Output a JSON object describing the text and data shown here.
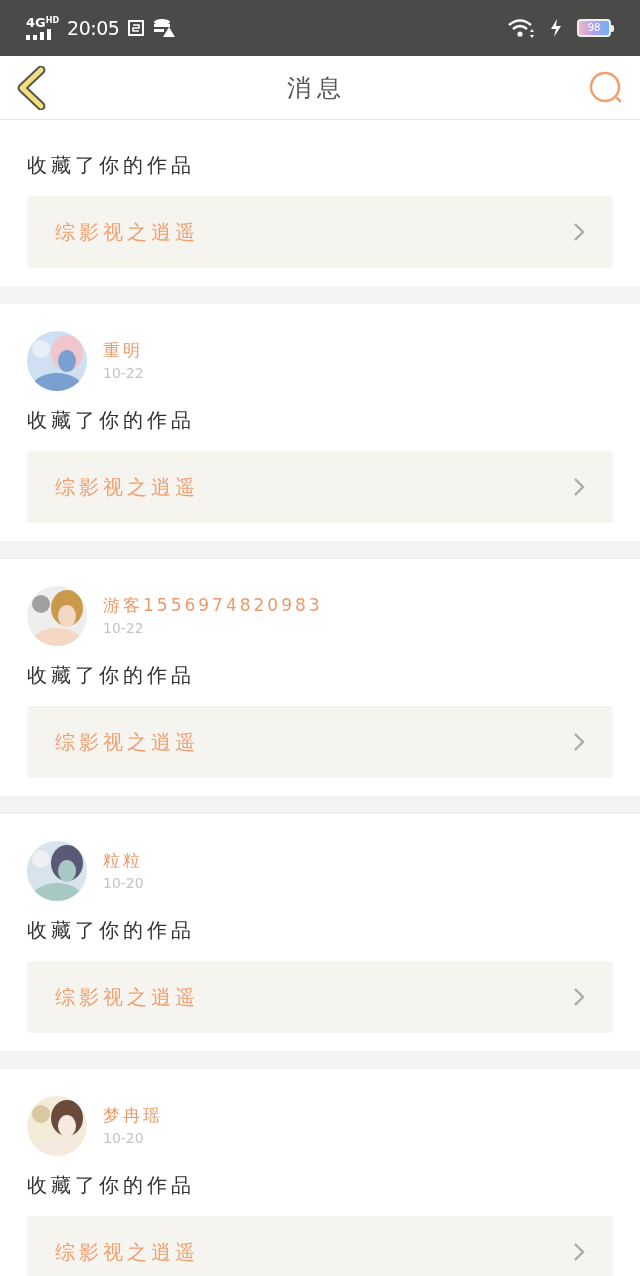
{
  "status_bar": {
    "network": "4G",
    "network_badge": "HD",
    "time": "20:05",
    "battery": "98"
  },
  "header": {
    "title": "消息"
  },
  "messages": [
    {
      "action": "收藏了你的作品",
      "work": "综影视之逍遥"
    },
    {
      "user": {
        "name": "重明",
        "date": "10-22"
      },
      "action": "收藏了你的作品",
      "work": "综影视之逍遥"
    },
    {
      "user": {
        "name": "游客1556974820983",
        "date": "10-22"
      },
      "action": "收藏了你的作品",
      "work": "综影视之逍遥"
    },
    {
      "user": {
        "name": "粒粒",
        "date": "10-20"
      },
      "action": "收藏了你的作品",
      "work": "综影视之逍遥"
    },
    {
      "user": {
        "name": "梦冉瑶",
        "date": "10-20"
      },
      "action": "收藏了你的作品",
      "work": "综影视之逍遥"
    }
  ]
}
